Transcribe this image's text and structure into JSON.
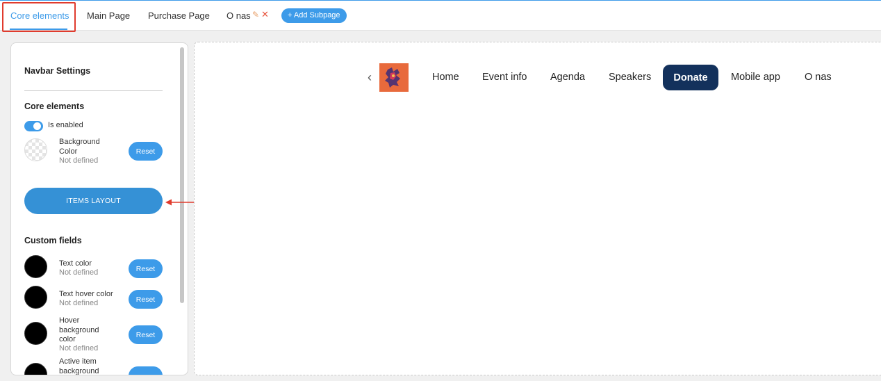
{
  "tabs": [
    {
      "label": "Core elements",
      "active": true
    },
    {
      "label": "Main Page"
    },
    {
      "label": "Purchase Page"
    },
    {
      "label": "O nas"
    }
  ],
  "tab_edit_icon": "✎",
  "tab_close_icon": "✕",
  "add_subpage_label": "+ Add Subpage",
  "panel": {
    "title": "Navbar Settings",
    "core_section": "Core elements",
    "toggle_label": "Is enabled",
    "toggle_on": true,
    "bg_color_label": "Background Color",
    "bg_color_value": "Not defined",
    "reset_label": "Reset",
    "items_layout_label": "ITEMS LAYOUT",
    "custom_section": "Custom fields",
    "custom_fields": [
      {
        "label": "Text color",
        "value": "Not defined",
        "swatch": "#000000"
      },
      {
        "label": "Text hover color",
        "value": "Not defined",
        "swatch": "#000000"
      },
      {
        "label": "Hover background color",
        "value": "Not defined",
        "swatch": "#000000"
      },
      {
        "label": "Active item background",
        "value": "",
        "swatch": "#000000"
      }
    ]
  },
  "preview": {
    "nav_items": [
      "Home",
      "Event info",
      "Agenda",
      "Speakers",
      "Mobile app",
      "O nas"
    ],
    "donate_label": "Donate",
    "donate_color": "#13315c"
  },
  "colors": {
    "accent": "#3d9be9",
    "annotation": "#e03b2d"
  }
}
